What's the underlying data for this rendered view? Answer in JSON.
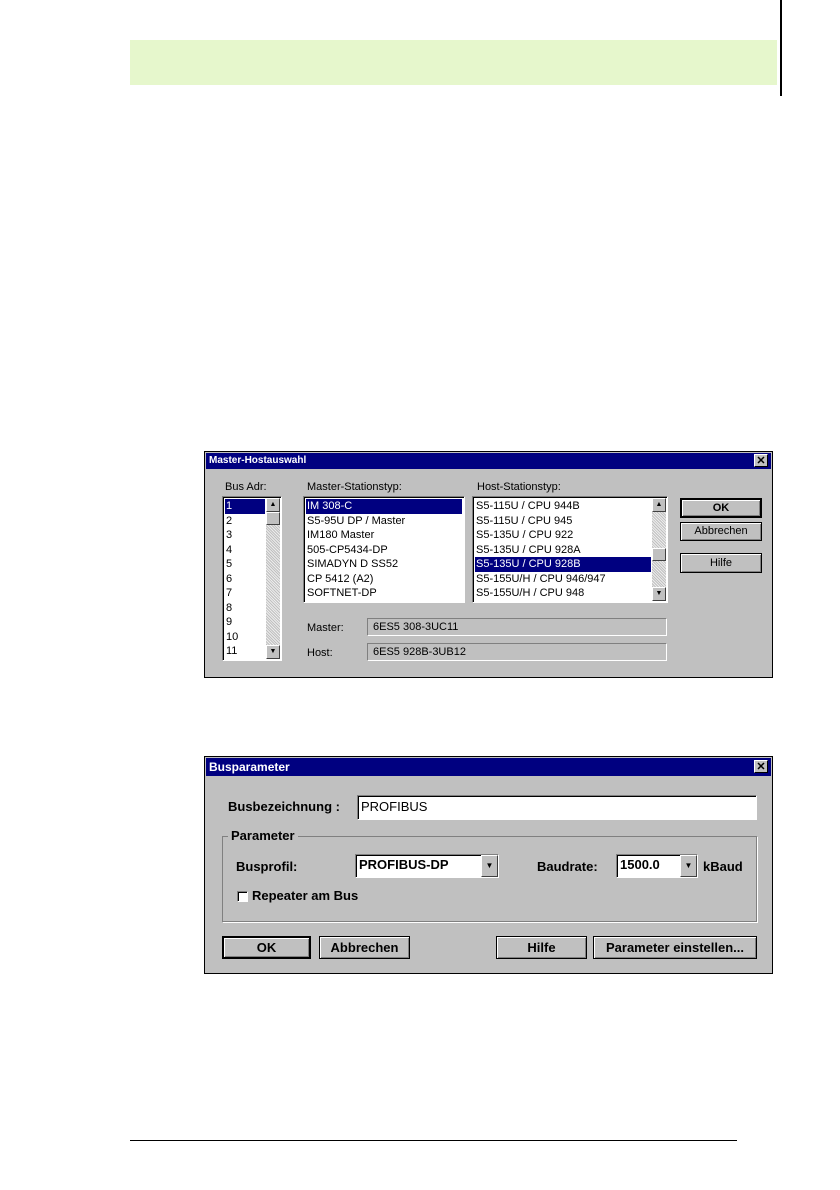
{
  "page": {
    "header_band_color": "#e6f7cc"
  },
  "master_dialog": {
    "title": "Master-Hostauswahl",
    "close_glyph": "✕",
    "bus_adr_label": "Bus Adr:",
    "bus_adr_items": [
      "1",
      "2",
      "3",
      "4",
      "5",
      "6",
      "7",
      "8",
      "9",
      "10",
      "11"
    ],
    "master_type_label": "Master-Stationstyp:",
    "master_types": [
      "IM 308-C",
      "S5-95U DP / Master",
      "IM180 Master",
      "505-CP5434-DP",
      "SIMADYN D SS52",
      "CP 5412 (A2)",
      "SOFTNET-DP"
    ],
    "host_type_label": "Host-Stationstyp:",
    "host_types": [
      "S5-115U / CPU 944B",
      "S5-115U / CPU 945",
      "S5-135U / CPU 922",
      "S5-135U / CPU 928A",
      "S5-135U / CPU 928B",
      "S5-155U/H / CPU 946/947",
      "S5-155U/H / CPU 948"
    ],
    "master_label": "Master:",
    "master_value": "6ES5 308-3UC11",
    "host_label": "Host:",
    "host_value": "6ES5 928B-3UB12",
    "ok_label": "OK",
    "cancel_label": "Abbrechen",
    "help_label": "Hilfe"
  },
  "bus_dialog": {
    "title": "Busparameter",
    "close_glyph": "✕",
    "busname_label": "Busbezeichnung :",
    "busname_value": "PROFIBUS",
    "group_label": "Parameter",
    "busprofil_label": "Busprofil:",
    "busprofil_value": "PROFIBUS-DP",
    "baudrate_label": "Baudrate:",
    "baudrate_value": "1500.0",
    "baud_unit": "kBaud",
    "repeater_label": "Repeater am Bus",
    "repeater_checked": false,
    "ok_label": "OK",
    "cancel_label": "Abbrechen",
    "help_label": "Hilfe",
    "params_label": "Parameter einstellen..."
  }
}
